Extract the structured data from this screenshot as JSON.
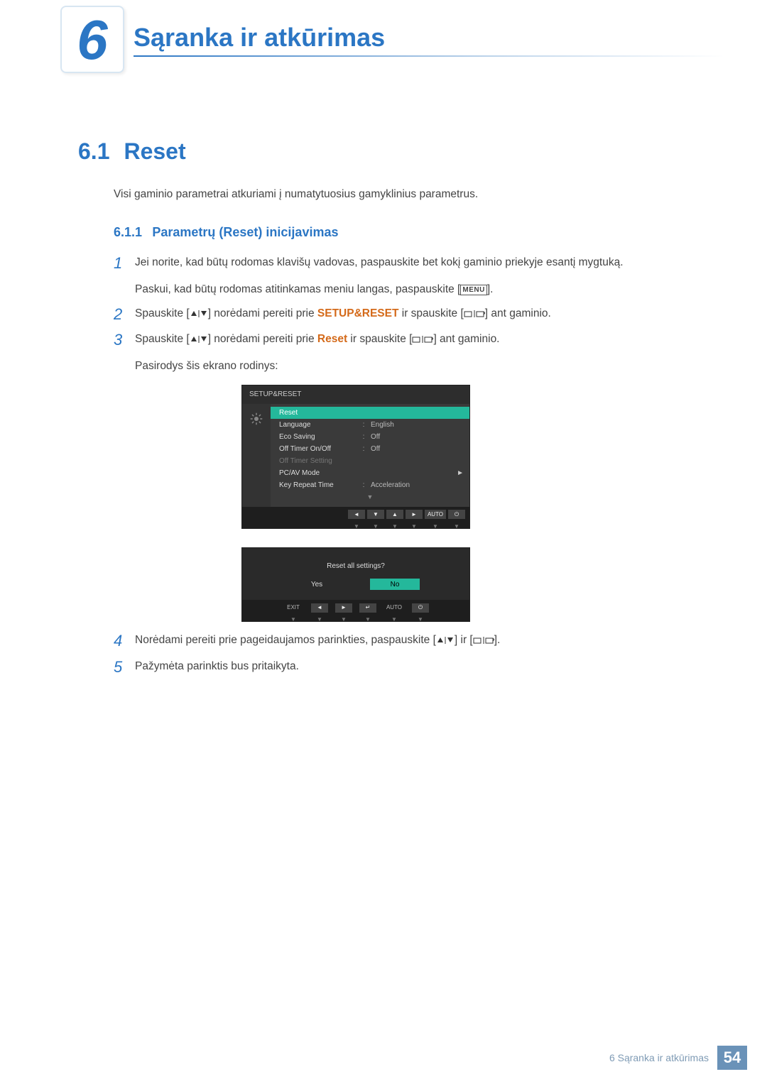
{
  "chapter": {
    "number": "6",
    "title": "Sąranka ir atkūrimas"
  },
  "section": {
    "number": "6.1",
    "title": "Reset"
  },
  "intro": "Visi gaminio parametrai atkuriami į numatytuosius gamyklinius parametrus.",
  "subsection": {
    "number": "6.1.1",
    "title": "Parametrų (Reset) inicijavimas"
  },
  "steps": {
    "s1": {
      "num": "1",
      "p1": "Jei norite, kad būtų rodomas klavišų vadovas, paspauskite bet kokį gaminio priekyje esantį mygtuką.",
      "p2a": "Paskui, kad būtų rodomas atitinkamas meniu langas, paspauskite [",
      "menu": "MENU",
      "p2b": "]."
    },
    "s2": {
      "num": "2",
      "a": "Spauskite [",
      "b": "] norėdami pereiti prie ",
      "kw": "SETUP&RESET",
      "c": " ir spauskite [",
      "d": "] ant gaminio."
    },
    "s3": {
      "num": "3",
      "a": "Spauskite [",
      "b": "] norėdami pereiti prie ",
      "kw": "Reset",
      "c": " ir spauskite [",
      "d": "] ant gaminio.",
      "tail": "Pasirodys šis ekrano rodinys:"
    },
    "s4": {
      "num": "4",
      "a": "Norėdami pereiti prie pageidaujamos parinkties, paspauskite [",
      "b": "] ir [",
      "c": "]."
    },
    "s5": {
      "num": "5",
      "text": "Pažymėta parinktis bus pritaikyta."
    }
  },
  "osd": {
    "title": "SETUP&RESET",
    "rows": [
      {
        "label": "Reset",
        "value": "",
        "sel": true
      },
      {
        "label": "Language",
        "value": "English"
      },
      {
        "label": "Eco Saving",
        "value": "Off"
      },
      {
        "label": "Off Timer On/Off",
        "value": "Off"
      },
      {
        "label": "Off Timer Setting",
        "value": "",
        "dim": true
      },
      {
        "label": "PC/AV Mode",
        "value": "",
        "arrow": true
      },
      {
        "label": "Key Repeat Time",
        "value": "Acceleration"
      }
    ],
    "nav": [
      "◄",
      "▼",
      "▲",
      "►",
      "AUTO",
      "⏻"
    ]
  },
  "osd2": {
    "question": "Reset all settings?",
    "yes": "Yes",
    "no": "No",
    "nav": {
      "exit": "EXIT",
      "auto": "AUTO"
    }
  },
  "footer": {
    "text": "6 Sąranka ir atkūrimas",
    "page": "54"
  }
}
